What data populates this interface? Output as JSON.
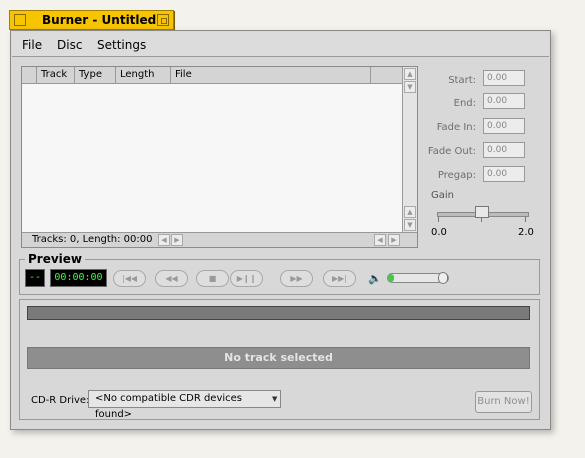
{
  "window": {
    "title": "Burner - Untitled"
  },
  "menu": {
    "items": [
      "File",
      "Disc",
      "Settings"
    ]
  },
  "tracklist": {
    "columns": [
      "Track",
      "Type",
      "Length",
      "File"
    ],
    "status": "Tracks: 0, Length: 00:00"
  },
  "fields": {
    "start": {
      "label": "Start:",
      "value": "0.00"
    },
    "end": {
      "label": "End:",
      "value": "0.00"
    },
    "fade_in": {
      "label": "Fade In:",
      "value": "0.00"
    },
    "fade_out": {
      "label": "Fade Out:",
      "value": "0.00"
    },
    "pregap": {
      "label": "Pregap:",
      "value": "0.00"
    }
  },
  "gain": {
    "label": "Gain",
    "min": "0.0",
    "max": "2.0",
    "value": 1.0
  },
  "preview": {
    "title": "Preview",
    "track_display": "--",
    "time_display": "00:00:00",
    "volume": 0.0
  },
  "burn": {
    "status": "No track selected",
    "cdr_label": "CD-R Drive:",
    "cdr_value": "<No compatible CDR devices found>",
    "burn_button": "Burn Now!"
  },
  "colors": {
    "titlebar": "#f6c400",
    "lcd_text": "#3cff3c"
  }
}
